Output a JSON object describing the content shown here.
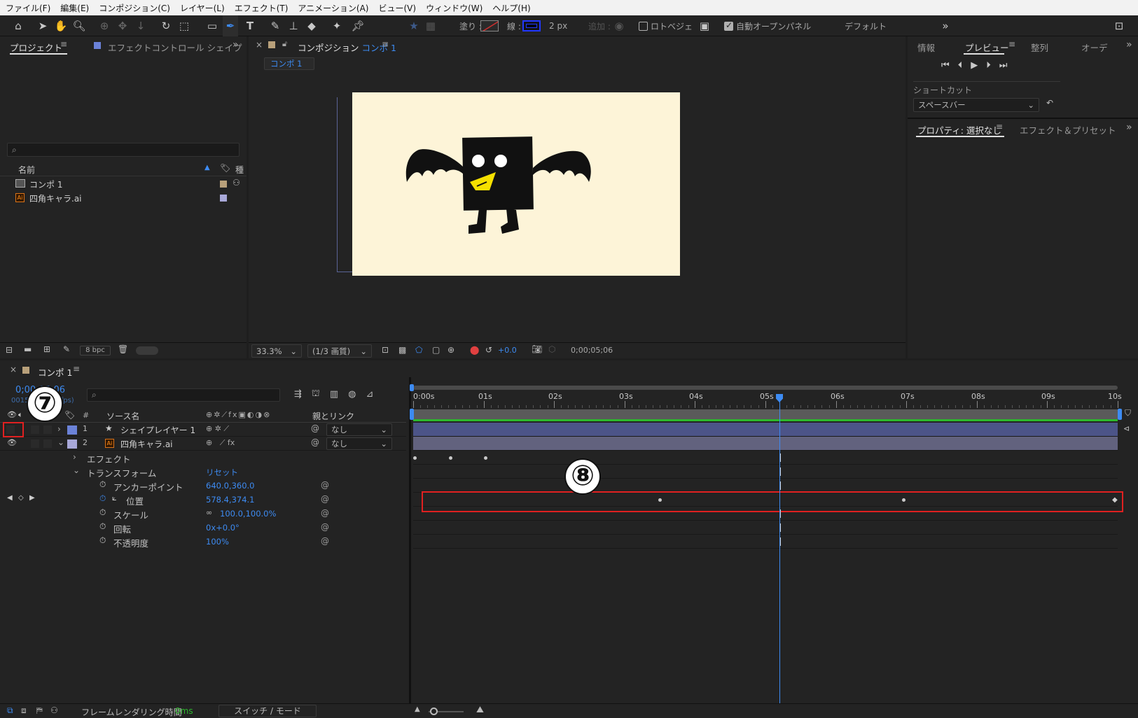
{
  "menu": [
    "ファイル(F)",
    "編集(E)",
    "コンポジション(C)",
    "レイヤー(L)",
    "エフェクト(T)",
    "アニメーション(A)",
    "ビュー(V)",
    "ウィンドウ(W)",
    "ヘルプ(H)"
  ],
  "toolbar": {
    "fill_label": "塗り :",
    "stroke_label": "線 :",
    "stroke_width": "2 px",
    "add_label": "追加 :",
    "bezier_label": "ロトベジェ",
    "auto_open_label": "自動オープンパネル",
    "workspace": "デフォルト",
    "fill_color": "#c83232",
    "stroke_color": "#2238ff"
  },
  "project": {
    "tab_project": "プロジェクト",
    "tab_effect": "エフェクトコントロール シェイプ",
    "col_name": "名前",
    "col_type": "種",
    "items": [
      {
        "name": "コンポ 1",
        "color": "#b8a07a"
      },
      {
        "name": "四角キャラ.ai",
        "color": "#a8a8d8"
      }
    ],
    "bpc": "8 bpc"
  },
  "viewer": {
    "tab_label": "コンポジション",
    "comp_name": "コンポ 1",
    "subtab": "コンポ 1",
    "zoom": "33.3%",
    "quality": "(1/3 画質)",
    "exposure": "+0.0",
    "timecode": "0;00;05;06",
    "canvas_color": "#fdf4d8"
  },
  "right": {
    "tab_info": "情報",
    "tab_preview": "プレビュー",
    "tab_align": "整列",
    "tab_audio": "オーデ",
    "shortcut_label": "ショートカット",
    "shortcut_value": "スペースバー",
    "tab_properties": "プロパティ: 選択なし",
    "tab_effects": "エフェクト＆プリセット"
  },
  "timeline": {
    "comp_tab": "コンポ 1",
    "timecode": "0;00;05;06",
    "fps": "00156 (29.97 fps)",
    "col_num": "#",
    "col_source": "ソース名",
    "col_parent": "親とリンク",
    "layers": [
      {
        "num": "1",
        "name": "シェイプレイヤー 1",
        "parent": "なし",
        "color": "#6b82d8"
      },
      {
        "num": "2",
        "name": "四角キャラ.ai",
        "parent": "なし",
        "color": "#a8a8d8"
      }
    ],
    "effects": "エフェクト",
    "transform": "トランスフォーム",
    "reset": "リセット",
    "props": [
      {
        "name": "アンカーポイント",
        "value": "640.0,360.0"
      },
      {
        "name": "位置",
        "value": "578.4,374.1"
      },
      {
        "name": "スケール",
        "value": "100.0,100.0%"
      },
      {
        "name": "回転",
        "value": "0x+0.0°"
      },
      {
        "name": "不透明度",
        "value": "100%"
      }
    ],
    "ticks": [
      "0:00s",
      "01s",
      "02s",
      "03s",
      "04s",
      "05s",
      "06s",
      "07s",
      "08s",
      "09s",
      "10s"
    ],
    "playhead_time": 5.2,
    "layer1_bar_color": "#5a6496",
    "layer2_bar_color": "#6e6e88"
  },
  "annotations": {
    "step7": "⑦",
    "step8": "⑧"
  },
  "status": {
    "render_label": "フレームレンダリング時間",
    "render_value": "0ms",
    "switch_mode": "スイッチ / モード"
  }
}
